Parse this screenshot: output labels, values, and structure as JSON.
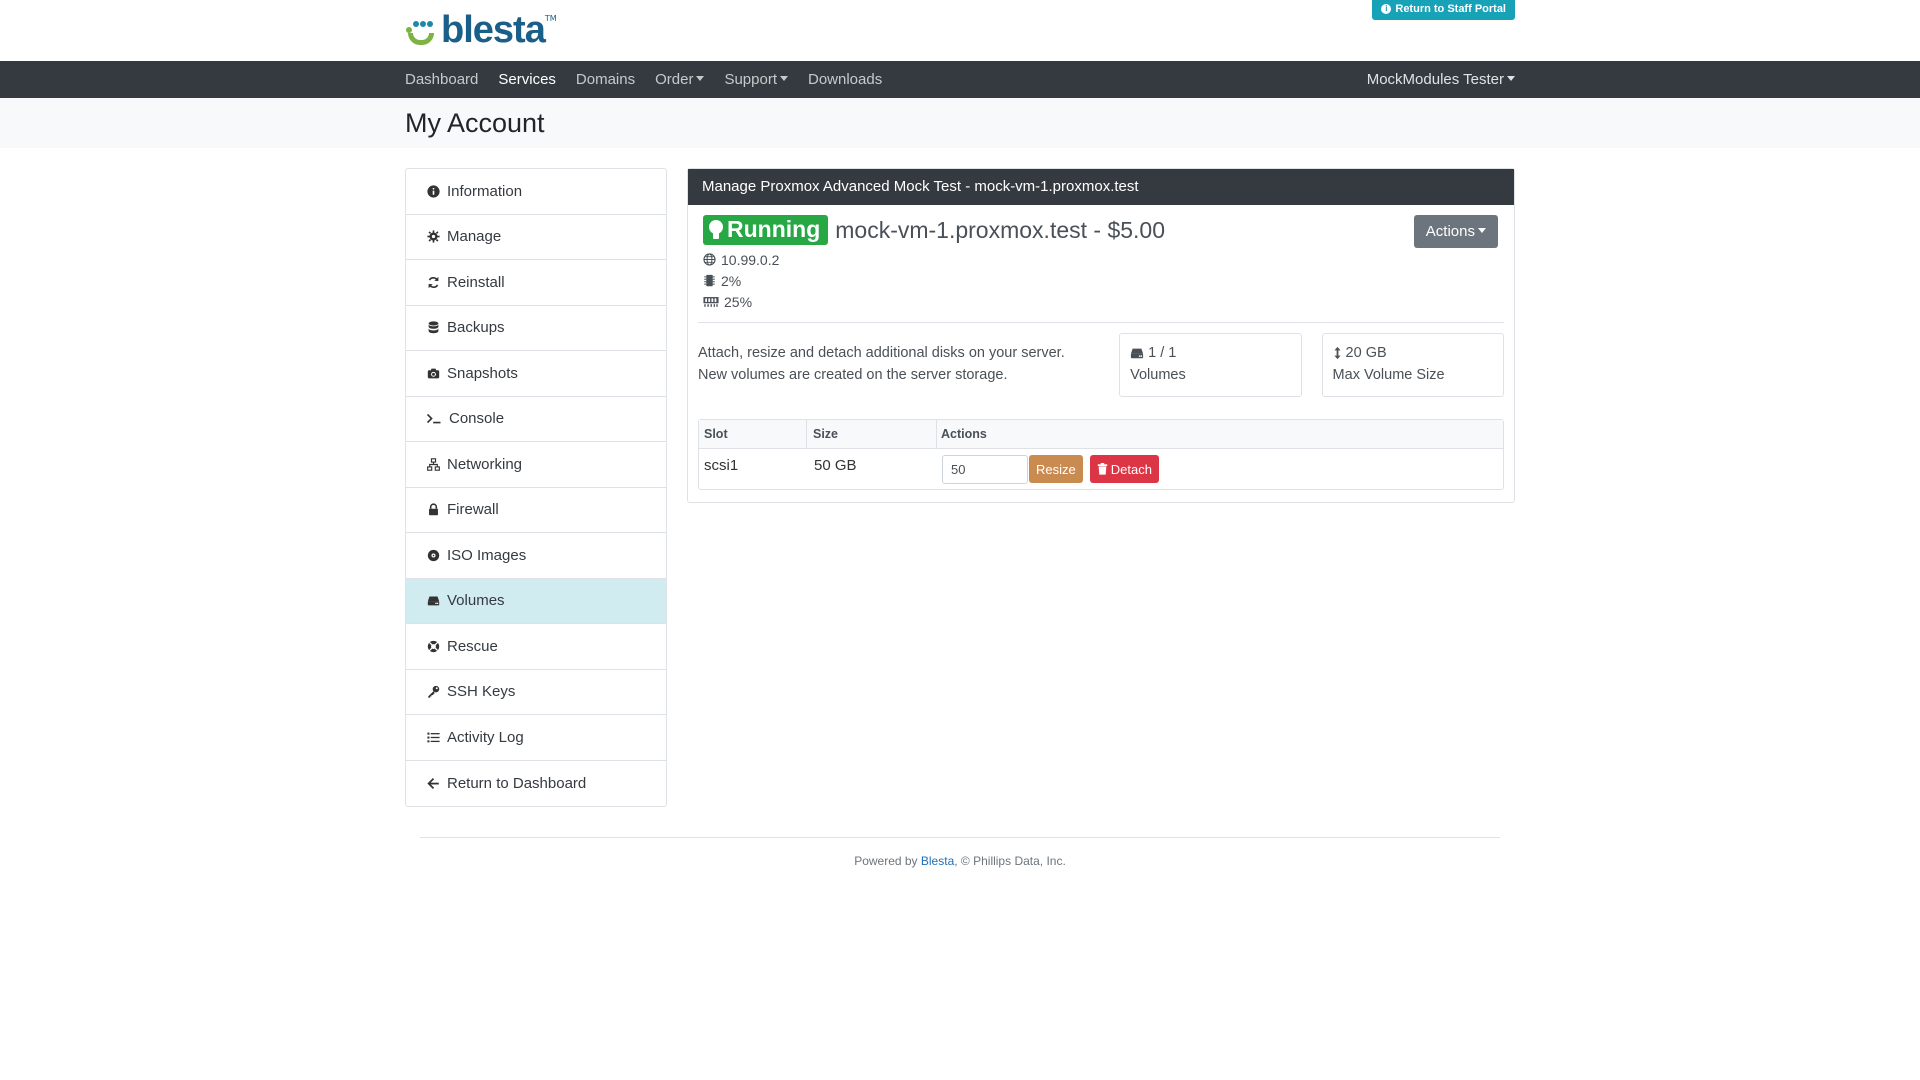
{
  "header": {
    "logo_text": "blesta",
    "logo_tm": "TM",
    "staff_portal_label": "Return to Staff Portal"
  },
  "nav": {
    "items": [
      {
        "label": "Dashboard",
        "dropdown": false
      },
      {
        "label": "Services",
        "dropdown": false,
        "active": true
      },
      {
        "label": "Domains",
        "dropdown": false
      },
      {
        "label": "Order",
        "dropdown": true
      },
      {
        "label": "Support",
        "dropdown": true
      },
      {
        "label": "Downloads",
        "dropdown": false
      }
    ],
    "user_label": "MockModules Tester"
  },
  "page_title": "My Account",
  "sidebar": {
    "items": [
      {
        "label": "Information",
        "icon": "info-circle-icon"
      },
      {
        "label": "Manage",
        "icon": "gear-icon"
      },
      {
        "label": "Reinstall",
        "icon": "sync-icon"
      },
      {
        "label": "Backups",
        "icon": "database-icon"
      },
      {
        "label": "Snapshots",
        "icon": "camera-icon"
      },
      {
        "label": "Console",
        "icon": "terminal-icon"
      },
      {
        "label": "Networking",
        "icon": "network-icon"
      },
      {
        "label": "Firewall",
        "icon": "lock-icon"
      },
      {
        "label": "ISO Images",
        "icon": "disc-icon"
      },
      {
        "label": "Volumes",
        "icon": "hdd-icon",
        "active": true
      },
      {
        "label": "Rescue",
        "icon": "life-ring-icon"
      },
      {
        "label": "SSH Keys",
        "icon": "key-icon"
      },
      {
        "label": "Activity Log",
        "icon": "list-icon"
      },
      {
        "label": "Return to Dashboard",
        "icon": "arrow-left-icon"
      }
    ]
  },
  "panel": {
    "heading": "Manage Proxmox Advanced Mock Test - mock-vm-1.proxmox.test",
    "status": "Running",
    "vm_title": "mock-vm-1.proxmox.test - $5.00",
    "actions_label": "Actions",
    "stats": {
      "ip": "10.99.0.2",
      "cpu": "2%",
      "memory": "25%"
    },
    "info_line1": "Attach, resize and detach additional disks on your server.",
    "info_line2": "New volumes are created on the server storage.",
    "volumes_count": "1 / 1",
    "volumes_label": "Volumes",
    "max_size_value": "20 GB",
    "max_size_label": "Max Volume Size",
    "table": {
      "headers": {
        "slot": "Slot",
        "size": "Size",
        "actions": "Actions"
      },
      "rows": [
        {
          "slot": "scsi1",
          "size": "50 GB",
          "input_value": "50",
          "resize_label": "Resize",
          "detach_label": "Detach"
        }
      ]
    }
  },
  "footer": {
    "prefix": "Powered by ",
    "link": "Blesta",
    "suffix": ", © Phillips Data, Inc."
  },
  "colors": {
    "navbar": "#343a40",
    "running": "#28a745",
    "staff_button": "#17a2b8",
    "active_sidebar": "#d1ecf1",
    "resize": "#c98b50",
    "detach": "#dc3545"
  }
}
